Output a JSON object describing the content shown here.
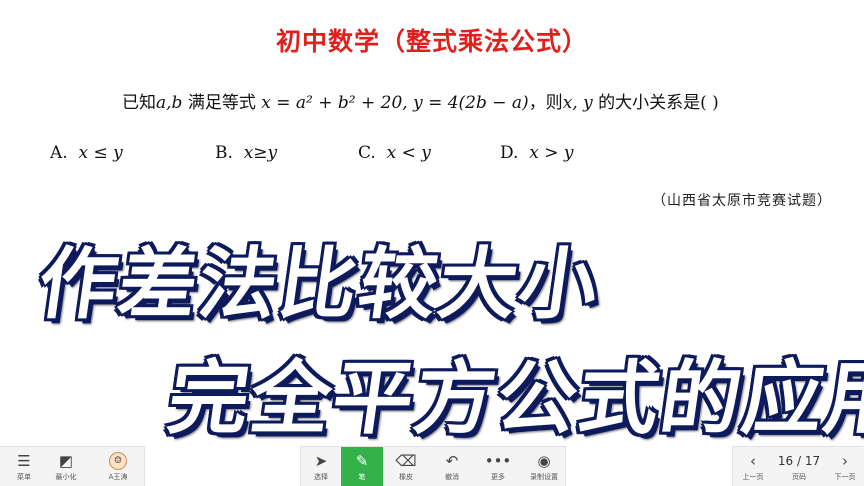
{
  "slide": {
    "title": "初中数学（整式乘法公式）",
    "question_prefix": "已知",
    "question_vars": "a,b",
    "question_mid": " 满足等式 ",
    "question_formula": "x = a² + b² + 20, y = 4(2b − a)",
    "question_suffix": "，则",
    "question_vars2": "x, y",
    "question_end": " 的大小关系是(        )",
    "options": [
      {
        "letter": "A.",
        "expr": "x ≤ y"
      },
      {
        "letter": "B.",
        "expr": "x≥y"
      },
      {
        "letter": "C.",
        "expr": "x < y"
      },
      {
        "letter": "D.",
        "expr": "x > y"
      }
    ],
    "source": "（山西省太原市竞赛试题）",
    "overlay_line1": "作差法比较大小",
    "overlay_line2": "完全平方公式的应用"
  },
  "toolbar": {
    "left": [
      {
        "label": "菜单",
        "icon": "menu-icon"
      },
      {
        "label": "最小化",
        "icon": "minimize-icon"
      },
      {
        "label": "A王涛",
        "icon": "avatar-icon"
      }
    ],
    "center": [
      {
        "label": "选择",
        "icon": "cursor-icon"
      },
      {
        "label": "笔",
        "icon": "pen-icon"
      },
      {
        "label": "橡皮",
        "icon": "eraser-icon"
      },
      {
        "label": "撤消",
        "icon": "undo-icon"
      },
      {
        "label": "更多",
        "icon": "more-icon"
      },
      {
        "label": "录制设置",
        "icon": "record-settings-icon"
      }
    ],
    "right": {
      "prev_label": "上一页",
      "page_label": "页码",
      "page_indicator": "16 / 17",
      "next_label": "下一页"
    }
  }
}
